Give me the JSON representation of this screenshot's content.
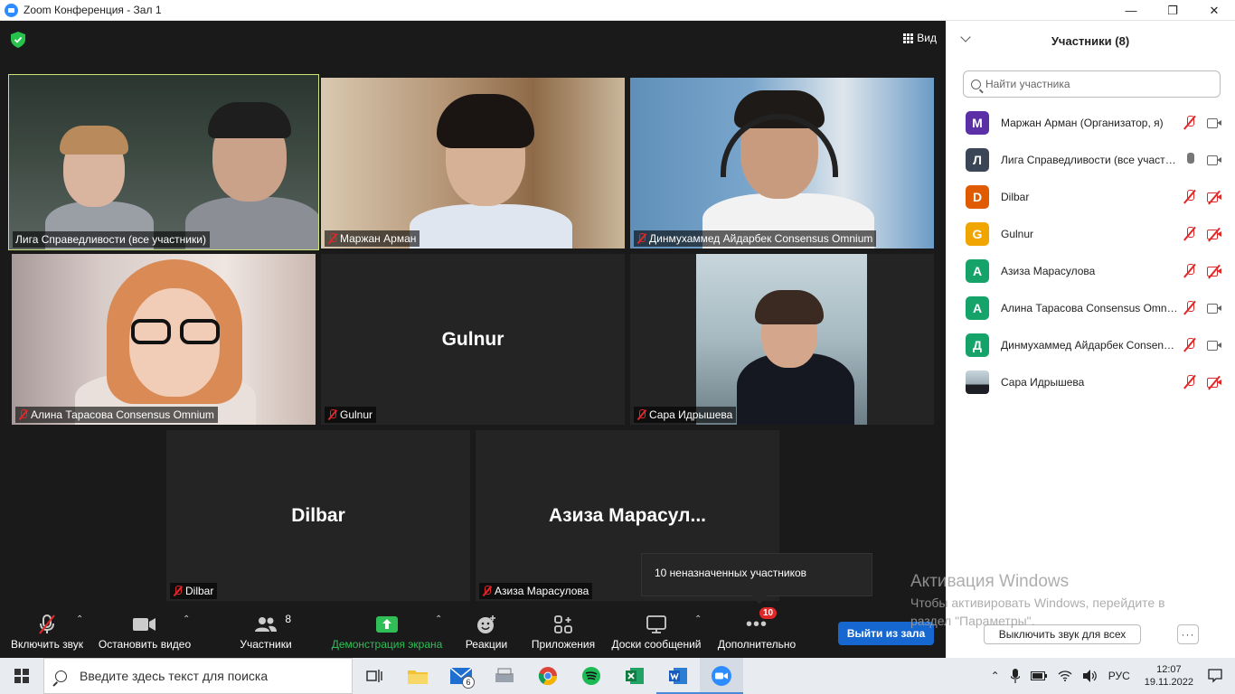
{
  "window": {
    "title": "Zoom Конференция - Зал 1",
    "controls": [
      "—",
      "❐",
      "✕"
    ]
  },
  "meeting": {
    "view_label": "Вид",
    "tiles": [
      {
        "name": "Лига Справедливости (все участники)",
        "muted": false,
        "video": true,
        "active": true
      },
      {
        "name": "Маржан Арман",
        "muted": true,
        "video": true
      },
      {
        "name": "Динмухаммед Айдарбек Consensus Omnium",
        "muted": true,
        "video": true
      },
      {
        "name": "Алина Тарасова Consensus Omnium",
        "muted": true,
        "video": true
      },
      {
        "name": "Gulnur",
        "center": "Gulnur",
        "muted": true,
        "video": false
      },
      {
        "name": "Сара Идрышева",
        "muted": true,
        "video": true
      },
      {
        "name": "Dilbar",
        "center": "Dilbar",
        "muted": true,
        "video": false
      },
      {
        "name": "Азиза Марасулова",
        "center": "Азиза  Марасул...",
        "muted": true,
        "video": false
      }
    ],
    "tooltip": "10 неназначенных участников"
  },
  "toolbar": {
    "audio": "Включить звук",
    "video": "Остановить видео",
    "participants": "Участники",
    "participants_count": "8",
    "share": "Демонстрация экрана",
    "reactions": "Реакции",
    "apps": "Приложения",
    "whiteboards": "Доски сообщений",
    "more": "Дополнительно",
    "more_badge": "10",
    "leave": "Выйти из зала"
  },
  "panel": {
    "title": "Участники (8)",
    "search_placeholder": "Найти участника",
    "participants": [
      {
        "initial": "М",
        "color": "#5b2fa5",
        "name": "Маржан Арман (Организатор, я)",
        "mic": "off",
        "cam": "on"
      },
      {
        "initial": "Л",
        "color": "#3a4556",
        "name": "Лига Справедливости (все участники)",
        "mic": "on",
        "cam": "on"
      },
      {
        "initial": "D",
        "color": "#e05a00",
        "name": "Dilbar",
        "mic": "off",
        "cam": "off"
      },
      {
        "initial": "G",
        "color": "#f0a500",
        "name": "Gulnur",
        "mic": "off",
        "cam": "off"
      },
      {
        "initial": "А",
        "color": "#16a36a",
        "name": "Азиза Марасулова",
        "mic": "off",
        "cam": "off"
      },
      {
        "initial": "А",
        "color": "#16a36a",
        "name": "Алина Тарасова Consensus Omnium",
        "mic": "off",
        "cam": "on"
      },
      {
        "initial": "Д",
        "color": "#16a36a",
        "name": "Динмухаммед Айдарбек Consensus Omnium",
        "mic": "off",
        "cam": "on"
      },
      {
        "initial": "",
        "color": "#7a8a9a",
        "name": "Сара Идрышева",
        "mic": "off",
        "cam": "off",
        "photo": true
      }
    ],
    "mute_all": "Выключить звук для всех",
    "more": "···"
  },
  "watermark": {
    "title": "Активация Windows",
    "subtitle": "Чтобы активировать Windows, перейдите в раздел \"Параметры\"."
  },
  "taskbar": {
    "search_placeholder": "Введите здесь текст для поиска",
    "mail_badge": "6",
    "lang": "РУС",
    "time": "12:07",
    "date": "19.11.2022"
  },
  "colors": {
    "active_speaker": "#cde47a",
    "leave": "#1668d0",
    "share_green": "#2fbf56",
    "muted_red": "#e02828"
  }
}
